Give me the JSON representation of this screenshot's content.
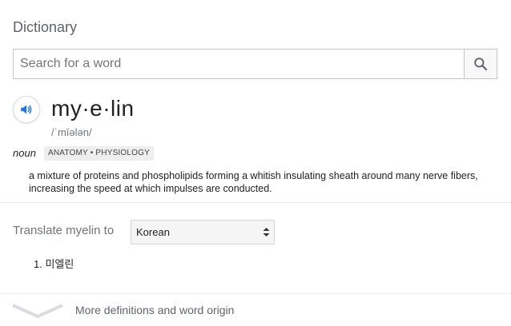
{
  "card": {
    "title": "Dictionary"
  },
  "search": {
    "placeholder": "Search for a word",
    "value": ""
  },
  "entry": {
    "headword": "my·e·lin",
    "phonetic": "/ˈmīələn/",
    "part_of_speech": "noun",
    "domain_label": "ANATOMY • PHYSIOLOGY",
    "definition": "a mixture of proteins and phospholipids forming a whitish insulating sheath around many nerve fibers, increasing the speed at which impulses are conducted."
  },
  "translate": {
    "label": "Translate myelin to",
    "selected_language": "Korean",
    "results": [
      {
        "number": "1.",
        "text": "미엘린"
      }
    ]
  },
  "more": {
    "label": "More definitions and word origin"
  },
  "colors": {
    "accent_blue": "#1a73e8",
    "muted_text": "#70757a",
    "divider": "#ebebeb"
  },
  "icons": {
    "search": "search-icon",
    "speaker": "speaker-icon",
    "select_arrows": "select-arrows-icon",
    "expand": "chevron-down-icon"
  }
}
